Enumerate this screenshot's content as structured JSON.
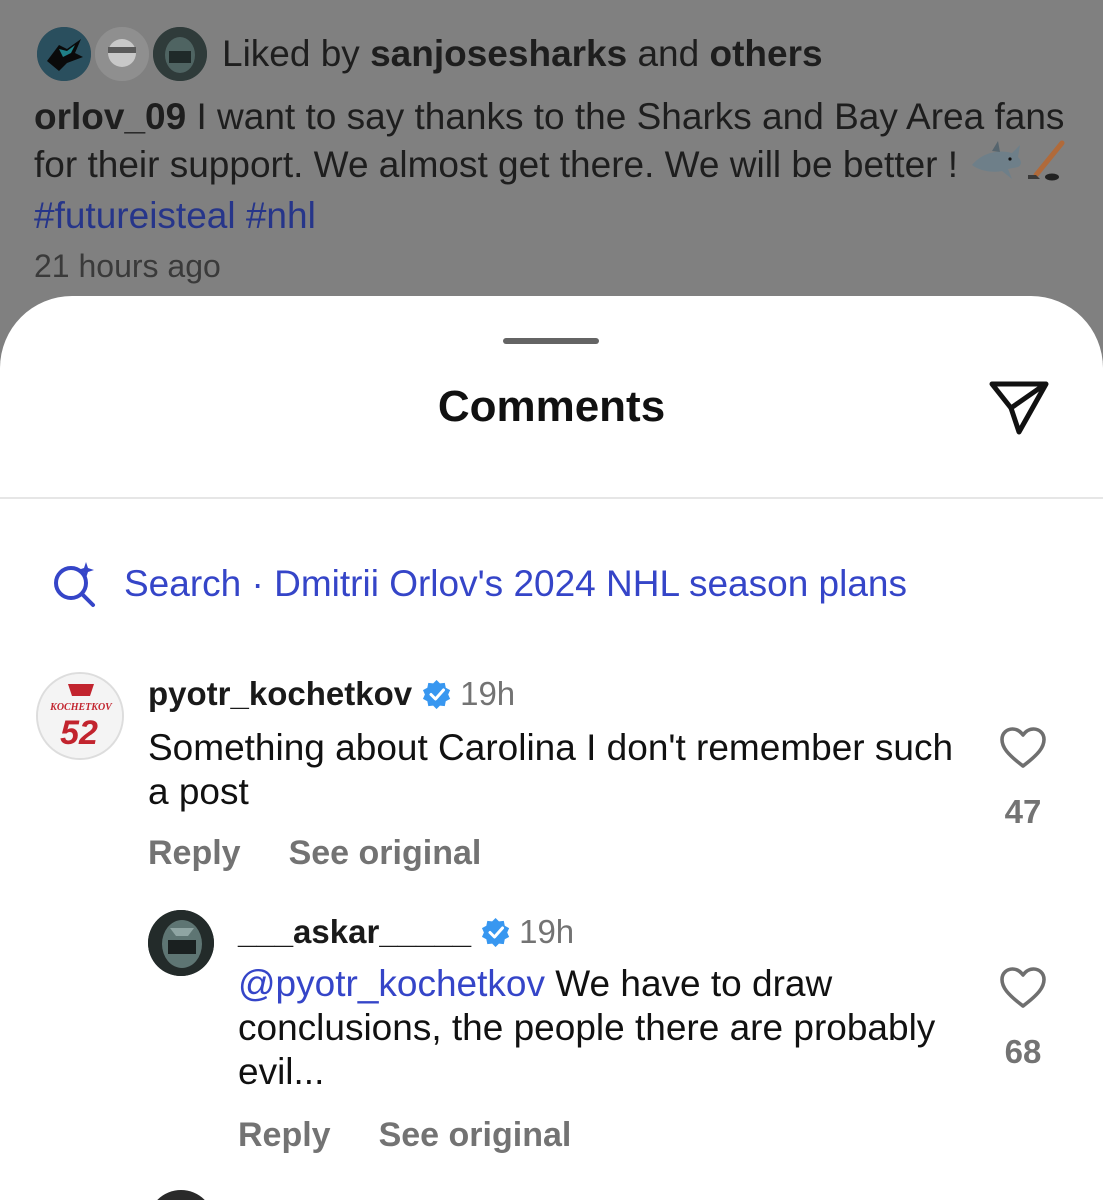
{
  "post": {
    "likes_prefix": "Liked by",
    "likes_user": "sanjosesharks",
    "likes_and": "and",
    "likes_others": "others",
    "author": "orlov_09",
    "caption_text": "I want to say thanks to the Sharks and Bay Area fans for their support. We almost get there. We will be better !",
    "caption_emojis": [
      "shark",
      "hockey stick"
    ],
    "hashtags": [
      "#futureisteal",
      "#nhl"
    ],
    "time": "21 hours ago"
  },
  "sheet": {
    "title": "Comments"
  },
  "search": {
    "label": "Search · Dmitrii Orlov's 2024 NHL season plans"
  },
  "comments": [
    {
      "user": "pyotr_kochetkov",
      "verified": true,
      "time": "19h",
      "text": "Something about Carolina I don't remember such a post",
      "reply_label": "Reply",
      "see_original_label": "See original",
      "likes": "47",
      "avatar_jersey_name": "KOCHETKOV",
      "avatar_jersey_number": "52"
    },
    {
      "user": "___askar_____",
      "verified": true,
      "time": "19h",
      "mention": "@pyotr_kochetkov",
      "text": "We have to draw conclusions, the people there are probably evil...",
      "reply_label": "Reply",
      "see_original_label": "See original",
      "likes": "68"
    }
  ],
  "colors": {
    "link_blue": "#3545c8",
    "verified_blue": "#3897f0",
    "overlay": "#808080"
  }
}
